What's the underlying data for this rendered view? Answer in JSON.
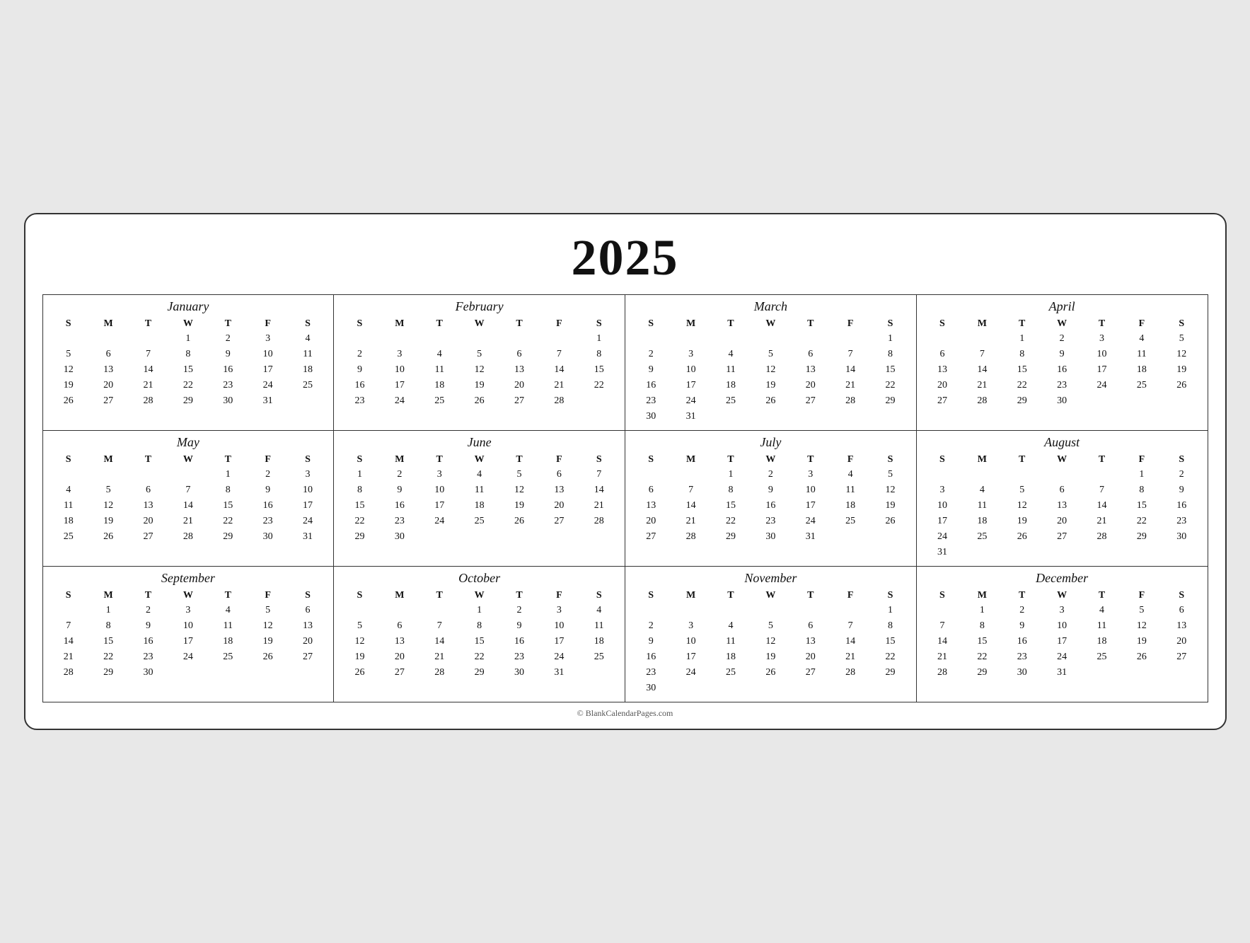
{
  "year": "2025",
  "footer": "© BlankCalendarPages.com",
  "dayHeaders": [
    "S",
    "M",
    "T",
    "W",
    "T",
    "F",
    "S"
  ],
  "months": [
    {
      "name": "January",
      "weeks": [
        [
          "",
          "",
          "",
          "1",
          "2",
          "3",
          "4"
        ],
        [
          "5",
          "6",
          "7",
          "8",
          "9",
          "10",
          "11"
        ],
        [
          "12",
          "13",
          "14",
          "15",
          "16",
          "17",
          "18"
        ],
        [
          "19",
          "20",
          "21",
          "22",
          "23",
          "24",
          "25"
        ],
        [
          "26",
          "27",
          "28",
          "29",
          "30",
          "31",
          ""
        ]
      ]
    },
    {
      "name": "February",
      "weeks": [
        [
          "",
          "",
          "",
          "",
          "",
          "",
          "1"
        ],
        [
          "2",
          "3",
          "4",
          "5",
          "6",
          "7",
          "8"
        ],
        [
          "9",
          "10",
          "11",
          "12",
          "13",
          "14",
          "15"
        ],
        [
          "16",
          "17",
          "18",
          "19",
          "20",
          "21",
          "22"
        ],
        [
          "23",
          "24",
          "25",
          "26",
          "27",
          "28",
          ""
        ]
      ]
    },
    {
      "name": "March",
      "weeks": [
        [
          "",
          "",
          "",
          "",
          "",
          "",
          "1"
        ],
        [
          "2",
          "3",
          "4",
          "5",
          "6",
          "7",
          "8"
        ],
        [
          "9",
          "10",
          "11",
          "12",
          "13",
          "14",
          "15"
        ],
        [
          "16",
          "17",
          "18",
          "19",
          "20",
          "21",
          "22"
        ],
        [
          "23",
          "24",
          "25",
          "26",
          "27",
          "28",
          "29"
        ],
        [
          "30",
          "31",
          "",
          "",
          "",
          "",
          ""
        ]
      ]
    },
    {
      "name": "April",
      "weeks": [
        [
          "",
          "",
          "1",
          "2",
          "3",
          "4",
          "5"
        ],
        [
          "6",
          "7",
          "8",
          "9",
          "10",
          "11",
          "12"
        ],
        [
          "13",
          "14",
          "15",
          "16",
          "17",
          "18",
          "19"
        ],
        [
          "20",
          "21",
          "22",
          "23",
          "24",
          "25",
          "26"
        ],
        [
          "27",
          "28",
          "29",
          "30",
          "",
          "",
          ""
        ]
      ]
    },
    {
      "name": "May",
      "weeks": [
        [
          "",
          "",
          "",
          "",
          "1",
          "2",
          "3"
        ],
        [
          "4",
          "5",
          "6",
          "7",
          "8",
          "9",
          "10"
        ],
        [
          "11",
          "12",
          "13",
          "14",
          "15",
          "16",
          "17"
        ],
        [
          "18",
          "19",
          "20",
          "21",
          "22",
          "23",
          "24"
        ],
        [
          "25",
          "26",
          "27",
          "28",
          "29",
          "30",
          "31"
        ]
      ]
    },
    {
      "name": "June",
      "weeks": [
        [
          "1",
          "2",
          "3",
          "4",
          "5",
          "6",
          "7"
        ],
        [
          "8",
          "9",
          "10",
          "11",
          "12",
          "13",
          "14"
        ],
        [
          "15",
          "16",
          "17",
          "18",
          "19",
          "20",
          "21"
        ],
        [
          "22",
          "23",
          "24",
          "25",
          "26",
          "27",
          "28"
        ],
        [
          "29",
          "30",
          "",
          "",
          "",
          "",
          ""
        ]
      ]
    },
    {
      "name": "July",
      "weeks": [
        [
          "",
          "",
          "1",
          "2",
          "3",
          "4",
          "5"
        ],
        [
          "6",
          "7",
          "8",
          "9",
          "10",
          "11",
          "12"
        ],
        [
          "13",
          "14",
          "15",
          "16",
          "17",
          "18",
          "19"
        ],
        [
          "20",
          "21",
          "22",
          "23",
          "24",
          "25",
          "26"
        ],
        [
          "27",
          "28",
          "29",
          "30",
          "31",
          "",
          ""
        ]
      ]
    },
    {
      "name": "August",
      "weeks": [
        [
          "",
          "",
          "",
          "",
          "",
          "1",
          "2"
        ],
        [
          "3",
          "4",
          "5",
          "6",
          "7",
          "8",
          "9"
        ],
        [
          "10",
          "11",
          "12",
          "13",
          "14",
          "15",
          "16"
        ],
        [
          "17",
          "18",
          "19",
          "20",
          "21",
          "22",
          "23"
        ],
        [
          "24",
          "25",
          "26",
          "27",
          "28",
          "29",
          "30"
        ],
        [
          "31",
          "",
          "",
          "",
          "",
          "",
          ""
        ]
      ]
    },
    {
      "name": "September",
      "weeks": [
        [
          "",
          "1",
          "2",
          "3",
          "4",
          "5",
          "6"
        ],
        [
          "7",
          "8",
          "9",
          "10",
          "11",
          "12",
          "13"
        ],
        [
          "14",
          "15",
          "16",
          "17",
          "18",
          "19",
          "20"
        ],
        [
          "21",
          "22",
          "23",
          "24",
          "25",
          "26",
          "27"
        ],
        [
          "28",
          "29",
          "30",
          "",
          "",
          "",
          ""
        ]
      ]
    },
    {
      "name": "October",
      "weeks": [
        [
          "",
          "",
          "",
          "1",
          "2",
          "3",
          "4"
        ],
        [
          "5",
          "6",
          "7",
          "8",
          "9",
          "10",
          "11"
        ],
        [
          "12",
          "13",
          "14",
          "15",
          "16",
          "17",
          "18"
        ],
        [
          "19",
          "20",
          "21",
          "22",
          "23",
          "24",
          "25"
        ],
        [
          "26",
          "27",
          "28",
          "29",
          "30",
          "31",
          ""
        ]
      ]
    },
    {
      "name": "November",
      "weeks": [
        [
          "",
          "",
          "",
          "",
          "",
          "",
          "1"
        ],
        [
          "2",
          "3",
          "4",
          "5",
          "6",
          "7",
          "8"
        ],
        [
          "9",
          "10",
          "11",
          "12",
          "13",
          "14",
          "15"
        ],
        [
          "16",
          "17",
          "18",
          "19",
          "20",
          "21",
          "22"
        ],
        [
          "23",
          "24",
          "25",
          "26",
          "27",
          "28",
          "29"
        ],
        [
          "30",
          "",
          "",
          "",
          "",
          "",
          ""
        ]
      ]
    },
    {
      "name": "December",
      "weeks": [
        [
          "",
          "1",
          "2",
          "3",
          "4",
          "5",
          "6"
        ],
        [
          "7",
          "8",
          "9",
          "10",
          "11",
          "12",
          "13"
        ],
        [
          "14",
          "15",
          "16",
          "17",
          "18",
          "19",
          "20"
        ],
        [
          "21",
          "22",
          "23",
          "24",
          "25",
          "26",
          "27"
        ],
        [
          "28",
          "29",
          "30",
          "31",
          "",
          "",
          ""
        ]
      ]
    }
  ]
}
